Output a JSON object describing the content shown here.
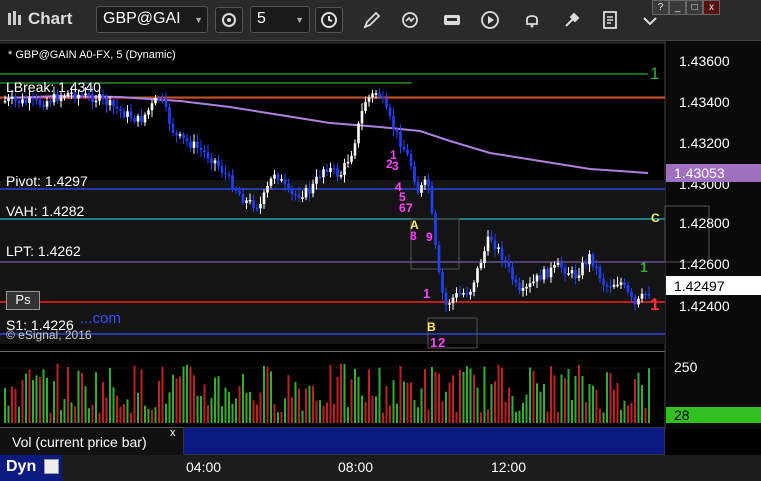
{
  "window": {
    "title": "Chart",
    "symbol": "GBP@GAI",
    "interval": "5",
    "help_label": "?",
    "minimize_label": "_",
    "maximize_label": "□",
    "close_label": "x"
  },
  "toolbar_icons": [
    "settings-gear-icon",
    "clock-icon",
    "pencil-icon",
    "refresh-cycle-icon",
    "scanner-icon",
    "play-icon",
    "bell-icon",
    "wrench-icon",
    "notes-icon",
    "more-icon"
  ],
  "chart": {
    "header": "* GBP@GAIN A0-FX, 5 (Dynamic)",
    "watermark": "© eSignal, 2016",
    "watermark2": "...com",
    "levels": [
      {
        "label": "LBreak: 1.4340",
        "price": 1.434,
        "color": "#ff3030"
      },
      {
        "label": "Pivot: 1.4297",
        "price": 1.4297,
        "color": "#3050ff"
      },
      {
        "label": "VAH: 1.4282",
        "price": 1.4282,
        "color": "#20c0c0"
      },
      {
        "label": "LPT: 1.4262",
        "price": 1.4262,
        "color": "#9070d0"
      },
      {
        "label": "S1: 1.4226",
        "price": 1.4226,
        "color": "#3050ff"
      }
    ],
    "price_axis": [
      "1.43600",
      "1.43400",
      "1.43200",
      "1.43000",
      "1.42800",
      "1.42600",
      "1.42400"
    ],
    "current_price": "1.42497",
    "ma_value": "1.43053",
    "ps_label": "Ps",
    "markers": {
      "a": "A",
      "b": "B",
      "c": "C",
      "num1a": "1",
      "num1b": "1",
      "num1c": "1",
      "num1d": "1",
      "seq": [
        "1",
        "2",
        "3",
        "4",
        "5",
        "6",
        "7",
        "8",
        "9",
        "1",
        "1",
        "2"
      ]
    }
  },
  "volume": {
    "label": "Vol (current price bar)",
    "close_label": "x",
    "axis_top": "250",
    "current": "28"
  },
  "time_axis": {
    "label": "Dyn",
    "ticks": [
      "04:00",
      "08:00",
      "12:00"
    ]
  },
  "colors": {
    "up_bar": "#ffffff",
    "down_bar": "#2040ff",
    "ma": "#b080e0",
    "vol_up": "#30b030",
    "vol_down": "#c02020",
    "highlight_vol": "#30c020"
  }
}
